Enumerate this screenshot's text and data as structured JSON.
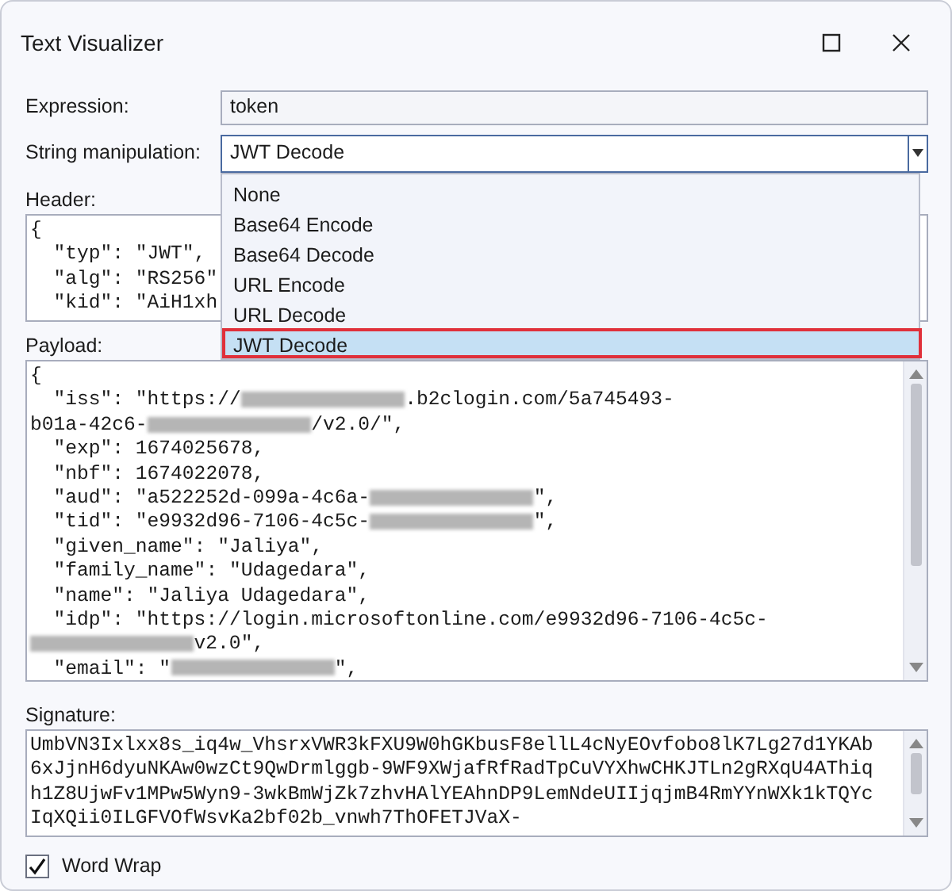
{
  "window": {
    "title": "Text Visualizer"
  },
  "expression": {
    "label": "Expression:",
    "value": "token"
  },
  "string_manipulation": {
    "label": "String manipulation:",
    "value": "JWT Decode",
    "expanded": true,
    "options": [
      {
        "label": "None",
        "selected": false
      },
      {
        "label": "Base64 Encode",
        "selected": false
      },
      {
        "label": "Base64 Decode",
        "selected": false
      },
      {
        "label": "URL Encode",
        "selected": false
      },
      {
        "label": "URL Decode",
        "selected": false
      },
      {
        "label": "JWT Decode",
        "selected": true
      }
    ]
  },
  "header": {
    "label": "Header:",
    "lines": [
      [
        {
          "kind": "text",
          "text": "{"
        }
      ],
      [
        {
          "kind": "text",
          "text": "  \"typ\": \"JWT\","
        }
      ],
      [
        {
          "kind": "text",
          "text": "  \"alg\": \"RS256\""
        }
      ],
      [
        {
          "kind": "text",
          "text": "  \"kid\": \"AiH1xh"
        }
      ]
    ]
  },
  "payload": {
    "label": "Payload:",
    "lines": [
      [
        {
          "kind": "text",
          "text": "{"
        }
      ],
      [
        {
          "kind": "text",
          "text": "  \"iss\": \"https://"
        },
        {
          "kind": "redacted"
        },
        {
          "kind": "text",
          "text": ".b2clogin.com/5a745493-"
        }
      ],
      [
        {
          "kind": "text",
          "text": "b01a-42c6-"
        },
        {
          "kind": "redacted"
        },
        {
          "kind": "text",
          "text": "/v2.0/\","
        }
      ],
      [
        {
          "kind": "text",
          "text": "  \"exp\": 1674025678,"
        }
      ],
      [
        {
          "kind": "text",
          "text": "  \"nbf\": 1674022078,"
        }
      ],
      [
        {
          "kind": "text",
          "text": "  \"aud\": \"a522252d-099a-4c6a-"
        },
        {
          "kind": "redacted"
        },
        {
          "kind": "text",
          "text": "\","
        }
      ],
      [
        {
          "kind": "text",
          "text": "  \"tid\": \"e9932d96-7106-4c5c-"
        },
        {
          "kind": "redacted"
        },
        {
          "kind": "text",
          "text": "\","
        }
      ],
      [
        {
          "kind": "text",
          "text": "  \"given_name\": \"Jaliya\","
        }
      ],
      [
        {
          "kind": "text",
          "text": "  \"family_name\": \"Udagedara\","
        }
      ],
      [
        {
          "kind": "text",
          "text": "  \"name\": \"Jaliya Udagedara\","
        }
      ],
      [
        {
          "kind": "text",
          "text": "  \"idp\": \"https://login.microsoftonline.com/e9932d96-7106-4c5c-"
        }
      ],
      [
        {
          "kind": "redacted"
        },
        {
          "kind": "text",
          "text": "v2.0\","
        }
      ],
      [
        {
          "kind": "text",
          "text": "  \"email\": \""
        },
        {
          "kind": "redacted"
        },
        {
          "kind": "text",
          "text": "\","
        }
      ]
    ]
  },
  "signature": {
    "label": "Signature:",
    "lines": [
      [
        {
          "kind": "text",
          "text": "UmbVN3Ixlxx8s_iq4w_VhsrxVWR3kFXU9W0hGKbusF8ellL4cNyEOvfobo8lK7Lg27d1YKAb"
        }
      ],
      [
        {
          "kind": "text",
          "text": "6xJjnH6dyuNKAw0wzCt9QwDrmlggb-9WF9XWjafRfRadTpCuVYXhwCHKJTLn2gRXqU4AThiq"
        }
      ],
      [
        {
          "kind": "text",
          "text": "h1Z8UjwFv1MPw5Wyn9-3wkBmWjZk7zhvHAlYEAhnDP9LemNdeUIIjqjmB4RmYYnWXk1kTQYc"
        }
      ],
      [
        {
          "kind": "text",
          "text": "IqXQii0ILGFVOfWsvKa2bf02b_vnwh7ThOFETJVaX-"
        }
      ]
    ]
  },
  "word_wrap": {
    "label": "Word Wrap",
    "checked": true
  }
}
